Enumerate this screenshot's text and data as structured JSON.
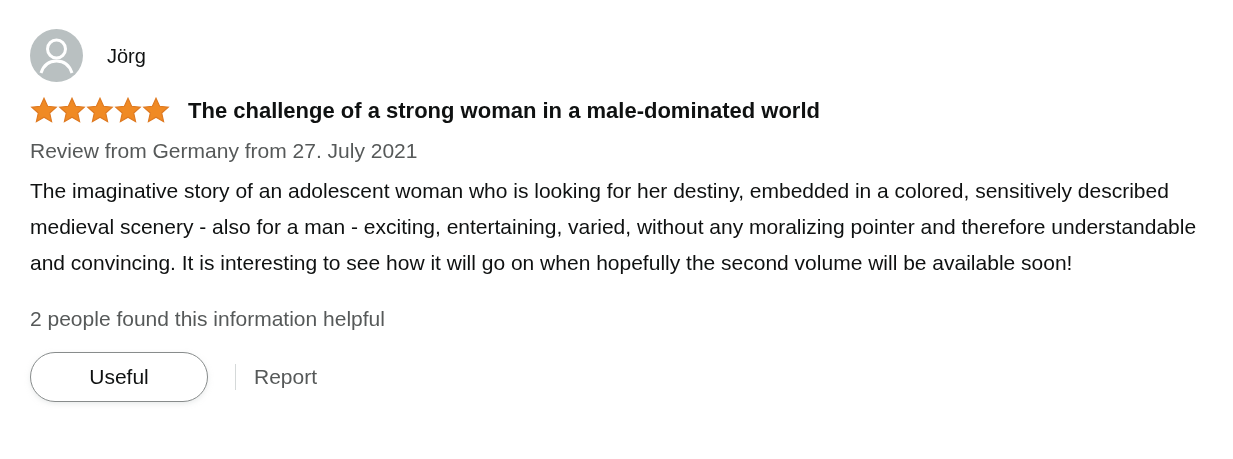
{
  "review": {
    "author": "Jörg",
    "stars": 5,
    "title": "The challenge of a strong woman in a male-dominated world",
    "meta": "Review from Germany from 27. July 2021",
    "body": "The imaginative story of an adolescent woman who is looking for her destiny, embedded in a colored, sensitively described medieval scenery - also for a man - exciting, entertaining, varied, without any moralizing pointer and therefore understandable and convincing. It is interesting to see how it will go on when hopefully the second volume will be available soon!",
    "helpful": "2 people found this information helpful"
  },
  "actions": [
    {
      "label": "Useful",
      "kind": "button"
    },
    {
      "label": "Report",
      "kind": "link"
    }
  ]
}
